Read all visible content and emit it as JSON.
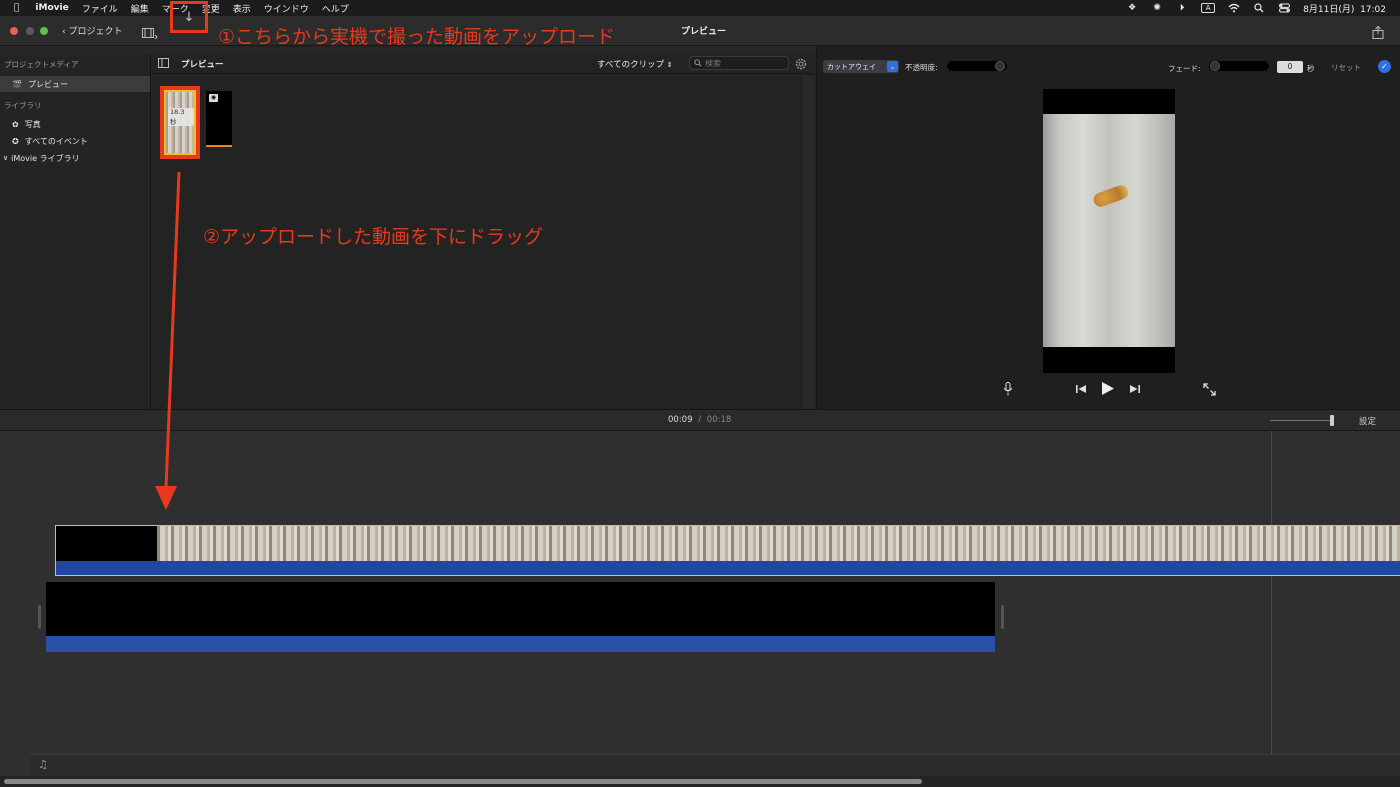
{
  "menubar": {
    "app": "iMovie",
    "items": [
      "ファイル",
      "編集",
      "マーク",
      "変更",
      "表示",
      "ウインドウ",
      "ヘルプ"
    ],
    "input_mode": "A",
    "datetime": "8月11日(月)  17:02"
  },
  "toolbar": {
    "back_label": "プロジェクト",
    "title": "プレビュー",
    "import_arrow": "↓"
  },
  "sidebar": {
    "project_media_header": "プロジェクトメディア",
    "project_item": "プレビュー",
    "library_header": "ライブラリ",
    "items": [
      "写真",
      "すべてのイベント"
    ],
    "imovie_library": "iMovie ライブラリ"
  },
  "browser": {
    "title": "プレビュー",
    "filter": "すべてのクリップ",
    "search_placeholder": "検索",
    "clip1_duration": "18.3 秒"
  },
  "viewer": {
    "cutaway_label": "カットアウェイ",
    "opacity_label": "不透明度:",
    "fade_label": "フェード:",
    "fade_value": "0",
    "fade_unit": "秒",
    "reset_label": "リセット"
  },
  "timeline": {
    "current_time": "00:09",
    "separator": "/",
    "total_time": "00:18",
    "settings_label": "設定"
  },
  "annotations": {
    "step1": "①こちらから実機で撮った動画をアップロード",
    "step2": "②アップロードした動画を下にドラッグ"
  },
  "colors": {
    "annotation": "#e8391e",
    "clip_border": "#f2c020",
    "audio_track": "#2247a0",
    "accent_blue": "#2f6fe0"
  }
}
